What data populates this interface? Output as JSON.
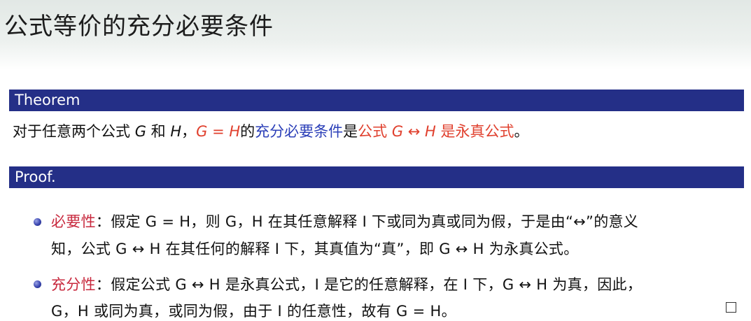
{
  "title": "公式等价的充分必要条件",
  "theorem": {
    "header": "Theorem",
    "p1": "对于任意两个公式 ",
    "G": "G",
    "he": " 和 ",
    "H": "H",
    "comma": "，",
    "eq": "G = H",
    "de": "的",
    "cond": "充分必要条件",
    "shi": "是",
    "gongshi": "公式 ",
    "equiv": "G ↔ H",
    "taut": " 是永真公式",
    "end": "。"
  },
  "proof": {
    "header": "Proof.",
    "necessity_label": "必要性",
    "line1": "：假定 G = H，则 G，H 在其任意解释 I 下或同为真或同为假，于是由“↔”的意义",
    "line2": "知，公式 G ↔ H 在其任何的解释 I 下，其真值为“真”，即 G ↔ H 为永真公式。",
    "sufficiency_label": "充分性",
    "line3": "：假定公式 G ↔ H 是永真公式，I 是它的任意解释，在 I 下，G ↔ H 为真，因此，",
    "line4": "G，H 或同为真，或同为假，由于 I 的任意性，故有 G = H。"
  }
}
